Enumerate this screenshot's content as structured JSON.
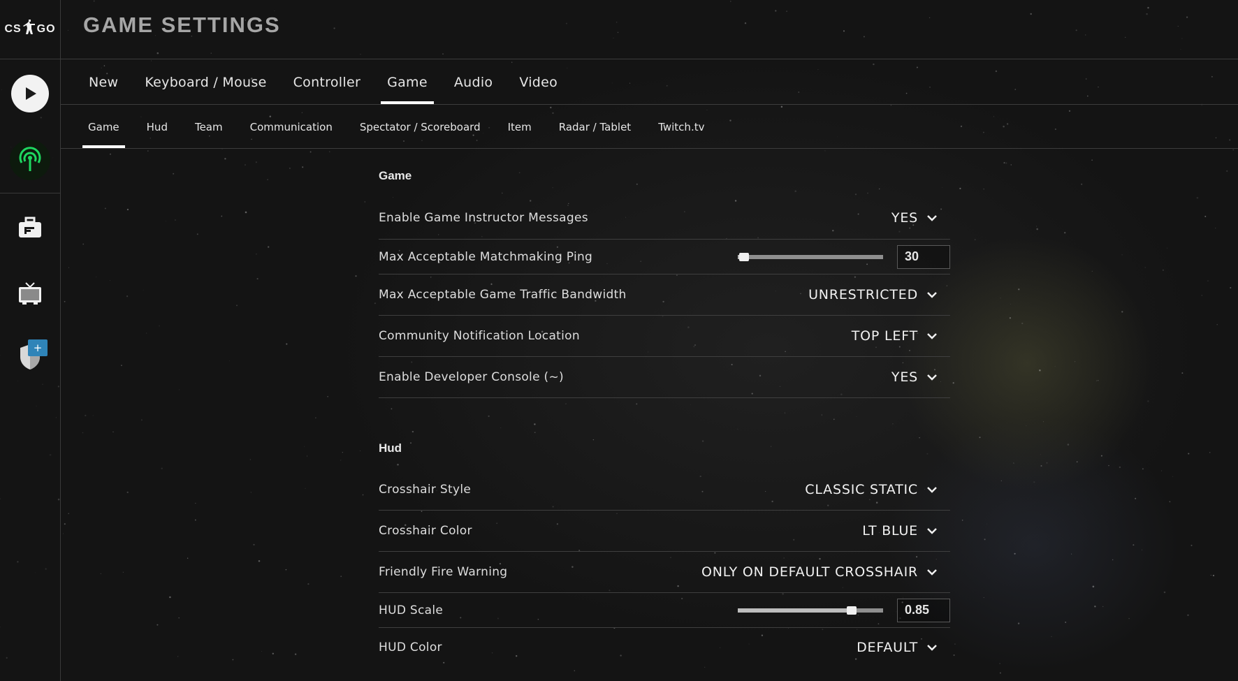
{
  "app": {
    "logo_left": "CS",
    "logo_right": "GO"
  },
  "header": {
    "title": "GAME SETTINGS"
  },
  "tabs": [
    {
      "label": "New",
      "active": false
    },
    {
      "label": "Keyboard / Mouse",
      "active": false
    },
    {
      "label": "Controller",
      "active": false
    },
    {
      "label": "Game",
      "active": true
    },
    {
      "label": "Audio",
      "active": false
    },
    {
      "label": "Video",
      "active": false
    }
  ],
  "subtabs": [
    {
      "label": "Game",
      "active": true
    },
    {
      "label": "Hud",
      "active": false
    },
    {
      "label": "Team",
      "active": false
    },
    {
      "label": "Communication",
      "active": false
    },
    {
      "label": "Spectator / Scoreboard",
      "active": false
    },
    {
      "label": "Item",
      "active": false
    },
    {
      "label": "Radar / Tablet",
      "active": false
    },
    {
      "label": "Twitch.tv",
      "active": false
    }
  ],
  "rail": {
    "items": [
      {
        "icon": "play-icon"
      },
      {
        "icon": "broadcast-antenna-icon"
      },
      {
        "icon": "briefcase-icon"
      },
      {
        "icon": "tv-icon"
      },
      {
        "icon": "shield-icon",
        "badge": "+"
      }
    ]
  },
  "sections": {
    "game": {
      "title": "Game",
      "instructor": {
        "label": "Enable Game Instructor Messages",
        "value": "YES"
      },
      "ping": {
        "label": "Max Acceptable Matchmaking Ping",
        "value": "30",
        "fraction": 0.0
      },
      "bandwidth": {
        "label": "Max Acceptable Game Traffic Bandwidth",
        "value": "UNRESTRICTED"
      },
      "notification": {
        "label": "Community Notification Location",
        "value": "TOP LEFT"
      },
      "console": {
        "label": "Enable Developer Console (~)",
        "value": "YES"
      }
    },
    "hud": {
      "title": "Hud",
      "crosshair_style": {
        "label": "Crosshair Style",
        "value": "CLASSIC STATIC"
      },
      "crosshair_color": {
        "label": "Crosshair Color",
        "value": "LT BLUE"
      },
      "friendly_fire": {
        "label": "Friendly Fire Warning",
        "value": "ONLY ON DEFAULT CROSSHAIR"
      },
      "hud_scale": {
        "label": "HUD Scale",
        "value": "0.85",
        "fraction": 0.75
      },
      "hud_color": {
        "label": "HUD Color",
        "value": "DEFAULT"
      }
    }
  },
  "colors": {
    "accent": "#ffffff",
    "badge": "#2f84b8",
    "radio": "#1ed760"
  }
}
